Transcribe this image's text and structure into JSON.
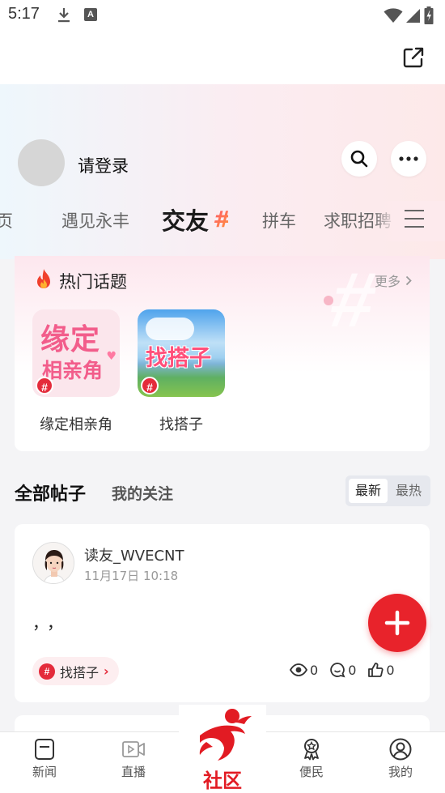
{
  "status_bar": {
    "time": "5:17"
  },
  "header": {
    "login_text": "请登录"
  },
  "tabs": [
    {
      "label": "首页"
    },
    {
      "label": "遇见永丰"
    },
    {
      "label": "交友"
    },
    {
      "label": "拼车"
    },
    {
      "label": "求职招聘"
    }
  ],
  "hot_topics": {
    "title": "热门话题",
    "more": "更多",
    "items": [
      {
        "name": "缘定相亲角",
        "thumb_line1": "缘定",
        "thumb_line2": "相亲角"
      },
      {
        "name": "找搭子",
        "thumb_text": "找搭子"
      }
    ],
    "badge": "#"
  },
  "posts_section": {
    "all_label": "全部帖子",
    "follow_label": "我的关注",
    "sort_new": "最新",
    "sort_hot": "最热"
  },
  "post": {
    "username": "读友_WVECNT",
    "time": "11月17日 10:18",
    "body": "，，",
    "tag": "找搭子",
    "views": "0",
    "comments": "0",
    "likes": "0"
  },
  "bottom_nav": [
    {
      "label": "新闻"
    },
    {
      "label": "直播"
    },
    {
      "label": "社区"
    },
    {
      "label": "便民"
    },
    {
      "label": "我的"
    }
  ],
  "colors": {
    "brand_red": "#e8232b",
    "tag_bg": "#fdeef0"
  }
}
